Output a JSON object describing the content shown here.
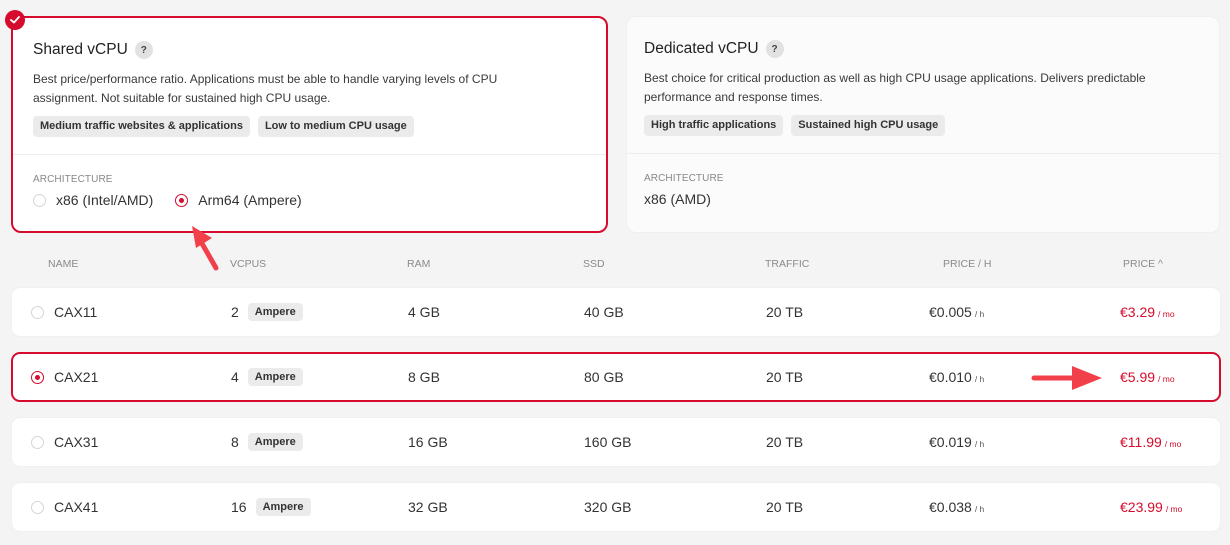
{
  "cards": [
    {
      "title": "Shared vCPU",
      "help_label": "?",
      "description": "Best price/performance ratio. Applications must be able to handle varying levels of CPU assignment. Not suitable for sustained high CPU usage.",
      "tags": [
        "Medium traffic websites & applications",
        "Low to medium CPU usage"
      ],
      "architecture_label": "ARCHITECTURE",
      "architecture_options": [
        {
          "label": "x86 (Intel/AMD)",
          "checked": false
        },
        {
          "label": "Arm64 (Ampere)",
          "checked": true
        }
      ],
      "selected": true
    },
    {
      "title": "Dedicated vCPU",
      "help_label": "?",
      "description": "Best choice for critical production as well as high CPU usage applications. Delivers predictable performance and response times.",
      "tags": [
        "High traffic applications",
        "Sustained high CPU usage"
      ],
      "architecture_label": "ARCHITECTURE",
      "architecture_value": "x86 (AMD)",
      "selected": false
    }
  ],
  "table": {
    "headers": {
      "name": "NAME",
      "vcpus": "VCPUS",
      "ram": "RAM",
      "ssd": "SSD",
      "traffic": "TRAFFIC",
      "price_h": "PRICE / H",
      "price": "PRICE ^"
    },
    "rows": [
      {
        "name": "CAX11",
        "vcpus": "2",
        "vcpu_tag": "Ampere",
        "ram": "4 GB",
        "ssd": "40 GB",
        "traffic": "20 TB",
        "price_h": "€0.005",
        "price_h_unit": "/ h",
        "price": "€3.29",
        "price_unit": "/ mo",
        "selected": false
      },
      {
        "name": "CAX21",
        "vcpus": "4",
        "vcpu_tag": "Ampere",
        "ram": "8 GB",
        "ssd": "80 GB",
        "traffic": "20 TB",
        "price_h": "€0.010",
        "price_h_unit": "/ h",
        "price": "€5.99",
        "price_unit": "/ mo",
        "selected": true
      },
      {
        "name": "CAX31",
        "vcpus": "8",
        "vcpu_tag": "Ampere",
        "ram": "16 GB",
        "ssd": "160 GB",
        "traffic": "20 TB",
        "price_h": "€0.019",
        "price_h_unit": "/ h",
        "price": "€11.99",
        "price_unit": "/ mo",
        "selected": false
      },
      {
        "name": "CAX41",
        "vcpus": "16",
        "vcpu_tag": "Ampere",
        "ram": "32 GB",
        "ssd": "320 GB",
        "traffic": "20 TB",
        "price_h": "€0.038",
        "price_h_unit": "/ h",
        "price": "€23.99",
        "price_unit": "/ mo",
        "selected": false
      }
    ]
  },
  "colors": {
    "accent": "#d50c2d",
    "annotation_arrow": "#f2404a",
    "background": "#f4f4f4"
  }
}
